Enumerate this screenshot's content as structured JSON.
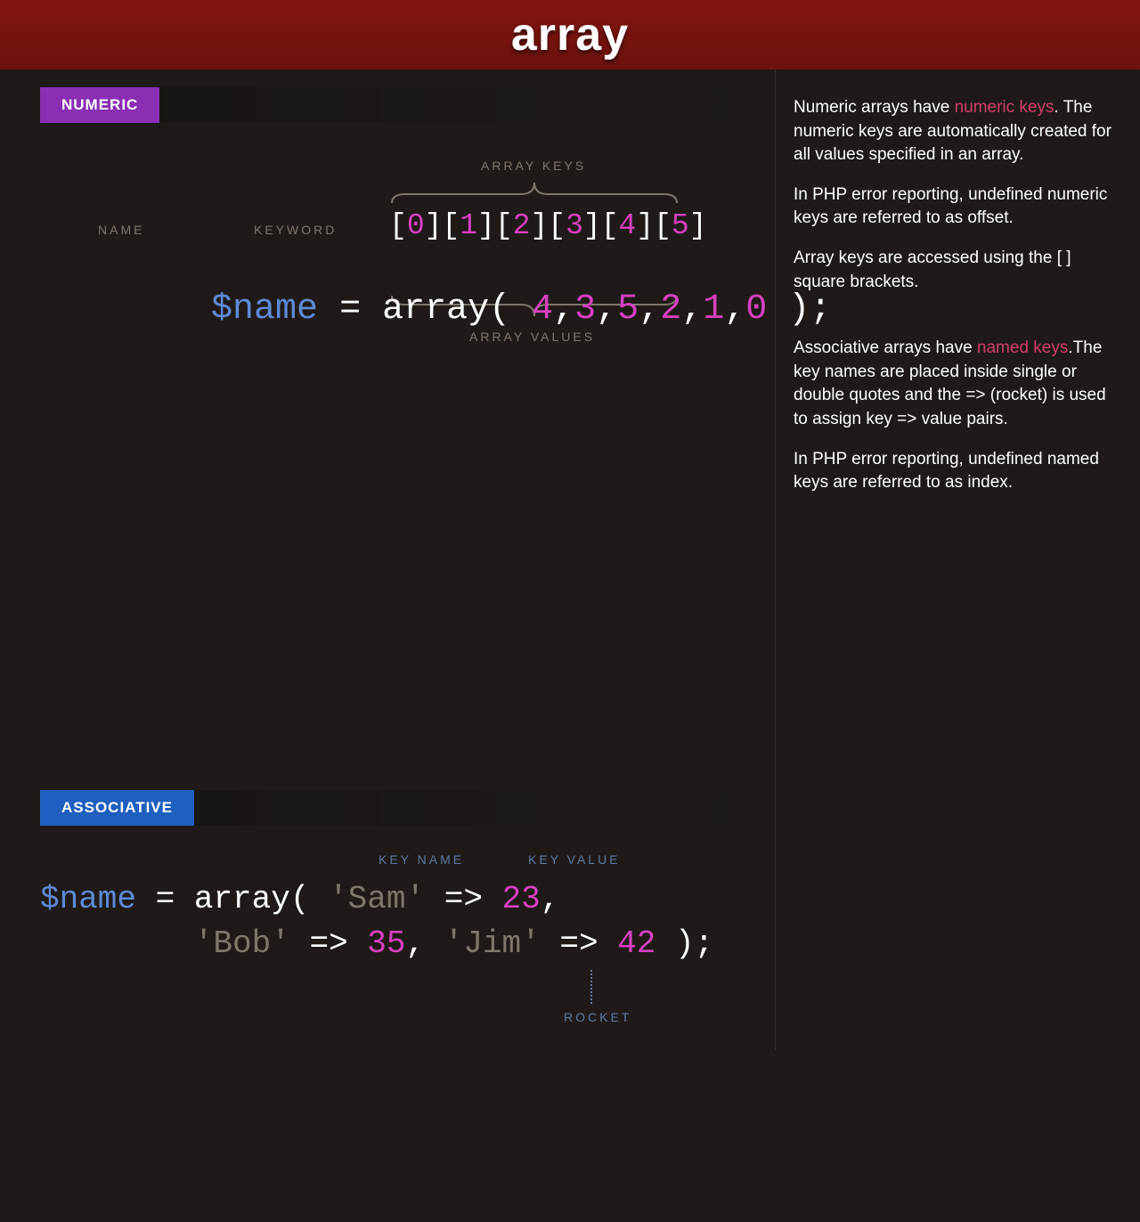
{
  "title": "array",
  "numeric": {
    "tag": "NUMERIC",
    "labels": {
      "name": "NAME",
      "keyword": "KEYWORD",
      "arrayKeys": "ARRAY KEYS",
      "arrayValues": "ARRAY VALUES"
    },
    "code": {
      "var": "$name",
      "op": " = ",
      "fn": "array( ",
      "keys": [
        "0",
        "1",
        "2",
        "3",
        "4",
        "5"
      ],
      "vals": [
        "4",
        "3",
        "5",
        "2",
        "1",
        "0"
      ],
      "close": " );"
    }
  },
  "assoc": {
    "tag": "ASSOCIATIVE",
    "labels": {
      "keyName": "KEY NAME",
      "keyValue": "KEY VALUE",
      "rocket": "ROCKET"
    },
    "code": {
      "var": "$name",
      "op": " = ",
      "fn": "array( ",
      "pairs": [
        {
          "k": "'Sam'",
          "v": "23"
        },
        {
          "k": "'Bob'",
          "v": "35"
        },
        {
          "k": "'Jim'",
          "v": "42"
        }
      ],
      "rocket": "=>",
      "close": " );"
    }
  },
  "sidebar": {
    "p1a": "Numeric arrays have ",
    "p1hl": "numeric keys",
    "p1b": ". The numeric keys are automatically created for all values specified in an array.",
    "p2": "In PHP error reporting, undefined numeric keys are referred to as offset.",
    "p3": "Array keys are accessed using the [  ] square brackets.",
    "p4a": "Associative arrays have ",
    "p4hl": "named keys",
    "p4b": ".The key names are placed inside single or double quotes and the => (rocket) is used to assign key => value pairs.",
    "p5": "In PHP error reporting, undefined named keys are referred to as index."
  }
}
